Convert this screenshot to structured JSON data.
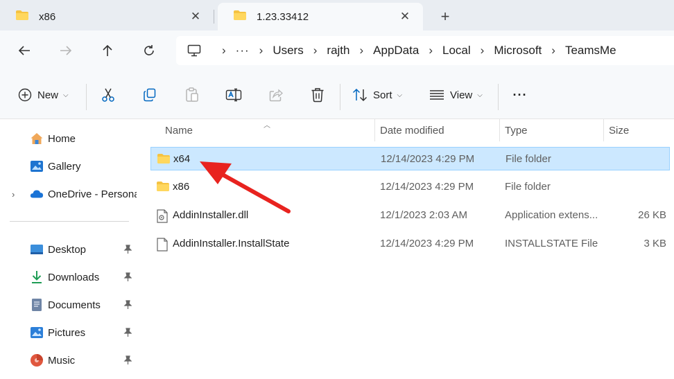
{
  "tabs": [
    {
      "title": "x86",
      "active": false,
      "close": "✕"
    },
    {
      "title": "1.23.33412",
      "active": true,
      "close": "✕"
    }
  ],
  "new_tab": "+",
  "address": {
    "more": "···",
    "crumbs": [
      "Users",
      "rajth",
      "AppData",
      "Local",
      "Microsoft",
      "TeamsMe"
    ]
  },
  "toolbar": {
    "new_label": "New",
    "sort_label": "Sort",
    "view_label": "View",
    "more_label": "···"
  },
  "sidebar": {
    "items": [
      {
        "label": "Home",
        "icon": "home-icon"
      },
      {
        "label": "Gallery",
        "icon": "gallery-icon"
      },
      {
        "label": "OneDrive - Personal",
        "icon": "onedrive-icon"
      },
      {
        "label": "Desktop",
        "icon": "desktop-icon",
        "pinned": true
      },
      {
        "label": "Downloads",
        "icon": "downloads-icon",
        "pinned": true
      },
      {
        "label": "Documents",
        "icon": "documents-icon",
        "pinned": true
      },
      {
        "label": "Pictures",
        "icon": "pictures-icon",
        "pinned": true
      },
      {
        "label": "Music",
        "icon": "music-icon",
        "pinned": true
      }
    ]
  },
  "columns": {
    "name": "Name",
    "date": "Date modified",
    "type": "Type",
    "size": "Size"
  },
  "files": [
    {
      "name": "x64",
      "date": "12/14/2023 4:29 PM",
      "type": "File folder",
      "size": "",
      "icon": "folder-icon",
      "selected": true
    },
    {
      "name": "x86",
      "date": "12/14/2023 4:29 PM",
      "type": "File folder",
      "size": "",
      "icon": "folder-icon",
      "selected": false
    },
    {
      "name": "AddinInstaller.dll",
      "date": "12/1/2023 2:03 AM",
      "type": "Application extens...",
      "size": "26 KB",
      "icon": "dll-file-icon",
      "selected": false
    },
    {
      "name": "AddinInstaller.InstallState",
      "date": "12/14/2023 4:29 PM",
      "type": "INSTALLSTATE File",
      "size": "3 KB",
      "icon": "file-icon",
      "selected": false
    }
  ],
  "colors": {
    "accent": "#0067c0",
    "selection_bg": "#cce8ff",
    "folder": "#f5c342",
    "annotation_arrow": "#e8231f"
  }
}
